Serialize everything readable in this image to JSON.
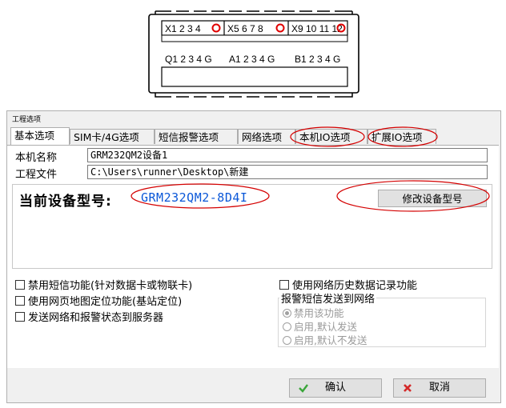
{
  "device": {
    "ports": [
      {
        "label": "X1 2 3 4"
      },
      {
        "label": "X5 6 7 8"
      },
      {
        "label": "X9 10 11 12"
      }
    ],
    "outputs": [
      "Q1 2 3 4 G",
      "A1 2 3 4 G",
      "B1 2 3 4 G"
    ]
  },
  "dialog": {
    "title": "工程选项",
    "tabs": [
      "基本选项",
      "SIM卡/4G选项",
      "短信报警选项",
      "网络选项",
      "本机IO选项",
      "扩展IO选项"
    ],
    "active_tab": 0,
    "device_name_label": "本机名称",
    "device_name_value": "GRM232QM2设备1",
    "project_file_label": "工程文件",
    "project_file_value": "C:\\Users\\runner\\Desktop\\新建",
    "model_caption": "当前设备型号:",
    "model_value": "GRM232QM2-8D4I",
    "change_model_button": "修改设备型号",
    "checkboxes_left": [
      {
        "label": "禁用短信功能(针对数据卡或物联卡)",
        "checked": false
      },
      {
        "label": "使用网页地图定位功能(基站定位)",
        "checked": false
      },
      {
        "label": "发送网络和报警状态到服务器",
        "checked": false
      }
    ],
    "history_checkbox": {
      "label": "使用网络历史数据记录功能",
      "checked": false
    },
    "alarm_group_title": "报警短信发送到网络",
    "alarm_options": [
      {
        "label": "禁用该功能",
        "selected": true
      },
      {
        "label": "启用,默认发送",
        "selected": false
      },
      {
        "label": "启用,默认不发送",
        "selected": false
      }
    ],
    "ok_button": "确认",
    "cancel_button": "取消"
  },
  "colors": {
    "annotation": "#d40000",
    "model_text": "#0a57d8",
    "ok_icon": "#3aa63a",
    "cancel_icon": "#d42a2a"
  }
}
